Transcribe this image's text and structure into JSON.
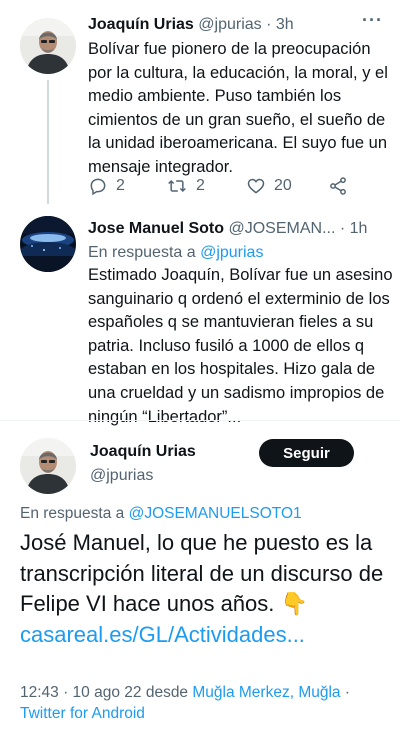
{
  "tweet1": {
    "name": "Joaquín Urias",
    "handle": "@jpurias",
    "sep": "·",
    "time": "3h",
    "text": "Bolívar fue pionero de la preocupación por la cultura, la educación, la moral, y el medio ambiente. Puso también los cimientos de un gran sueño, el sueño de la unidad iberoamericana. El suyo fue un mensaje integrador.",
    "reply_count": "2",
    "retweet_count": "2",
    "like_count": "20"
  },
  "tweet2": {
    "name": "Jose Manuel Soto",
    "handle": "@JOSEMAN...",
    "sep": "·",
    "time": "1h",
    "reply_prefix": "En respuesta a ",
    "reply_handle": "@jpurias",
    "text": "Estimado Joaquín, Bolívar fue un asesino sanguinario q ordenó el exterminio de los españoles q se mantuvieran fieles a su patria. Incluso fusiló a 1000 de ellos q estaban en los hospitales. Hizo gala de una crueldad y un sadismo impropios de ningún “Libertador”..."
  },
  "tweet3": {
    "name": "Joaquín Urias",
    "handle": "@jpurias",
    "follow_label": "Seguir",
    "reply_prefix": "En respuesta a ",
    "reply_handle": "@JOSEMANUELSOTO1",
    "text": "José Manuel, lo que he puesto es la transcripción literal de un discurso de Felipe VI hace unos años.",
    "emoji": "👇",
    "link": "casareal.es/GL/Actividades...",
    "timestamp": "12:43 · 10 ago 22 desde ",
    "location": "Muğla Merkez, Muğla",
    "sep": " ·",
    "source": "Twitter for Android"
  },
  "icons": {
    "more": "more-horizontal-icon",
    "reply": "reply-bubble-icon",
    "retweet": "retweet-icon",
    "like": "heart-icon",
    "share": "share-icon"
  },
  "colors": {
    "link": "#1d9bf0",
    "secondary": "#536471",
    "primary_text": "#0f1419",
    "follow_bg": "#0f1419"
  }
}
